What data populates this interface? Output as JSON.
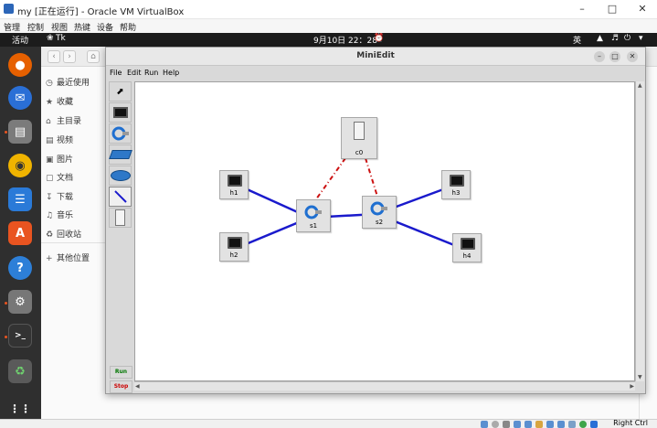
{
  "host": {
    "title": "my [正在运行] - Oracle VM VirtualBox",
    "menu": [
      "管理",
      "控制",
      "视图",
      "热键",
      "设备",
      "帮助"
    ],
    "status_text": "Right Ctrl"
  },
  "topbar": {
    "activities": "活动",
    "app": "Tk",
    "clock": "9月10日  22：28",
    "lang": "英"
  },
  "files": {
    "sidebar": [
      "最近使用",
      "收藏",
      "主目录",
      "视频",
      "图片",
      "文档",
      "下载",
      "音乐",
      "回收站"
    ],
    "other": "其他位置"
  },
  "miniedit": {
    "title": "MiniEdit",
    "menu": [
      "File",
      "Edit",
      "Run",
      "Help"
    ],
    "run_label": "Run",
    "stop_label": "Stop",
    "nodes": {
      "c0": "c0",
      "s1": "s1",
      "s2": "s2",
      "h1": "h1",
      "h2": "h2",
      "h3": "h3",
      "h4": "h4"
    },
    "colors": {
      "link": "#1a1acc",
      "controller_link": "#cc1111",
      "stop_text": "#cc0000",
      "run_text": "#007700"
    }
  }
}
